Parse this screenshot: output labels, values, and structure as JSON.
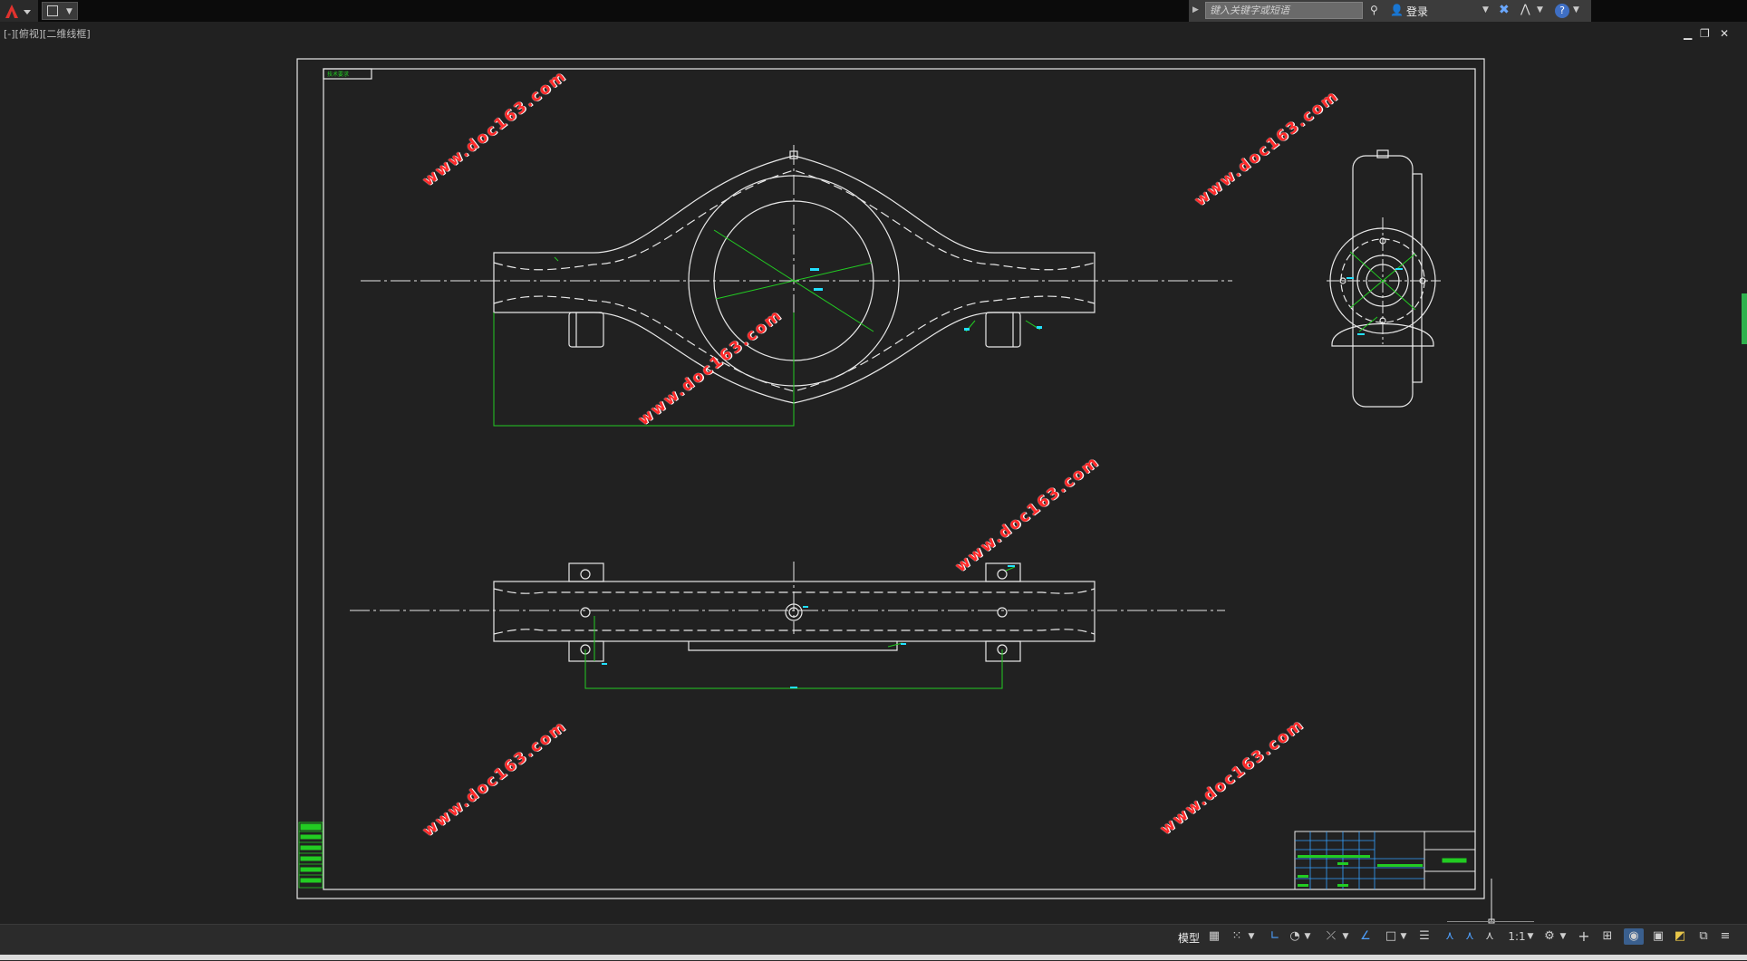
{
  "app": {
    "search_placeholder": "键入关键字或短语",
    "login_label": "登录",
    "viewport_label": "[-][俯视][二维线框]"
  },
  "window_controls": {
    "minimize": "▁",
    "restore": "❐",
    "close": "✕"
  },
  "drawing": {
    "title_box_text": "技术要求",
    "watermark": "www.doc163.com"
  },
  "statusbar": {
    "model_label": "模型",
    "scale_label": "1:1",
    "icons": [
      "grid-icon",
      "snap-icon",
      "ortho-icon",
      "polar-icon",
      "osnap-icon",
      "otrack-icon",
      "lineweight-icon",
      "transparency-icon",
      "selection-cycling-icon",
      "annotation-visibility-icon",
      "autoscale-icon",
      "annotation-scale-icon",
      "workspace-gear-icon",
      "plus-icon",
      "units-icon",
      "isolate-icon",
      "hardware-accel-icon",
      "clean-screen-icon",
      "customize-icon"
    ]
  },
  "colors": {
    "background": "#212121",
    "drawing_lines": "#e8e8e8",
    "dimension_lines": "#22cc22",
    "watermark": "#ff2a2a",
    "accent": "#3f6fc4"
  }
}
